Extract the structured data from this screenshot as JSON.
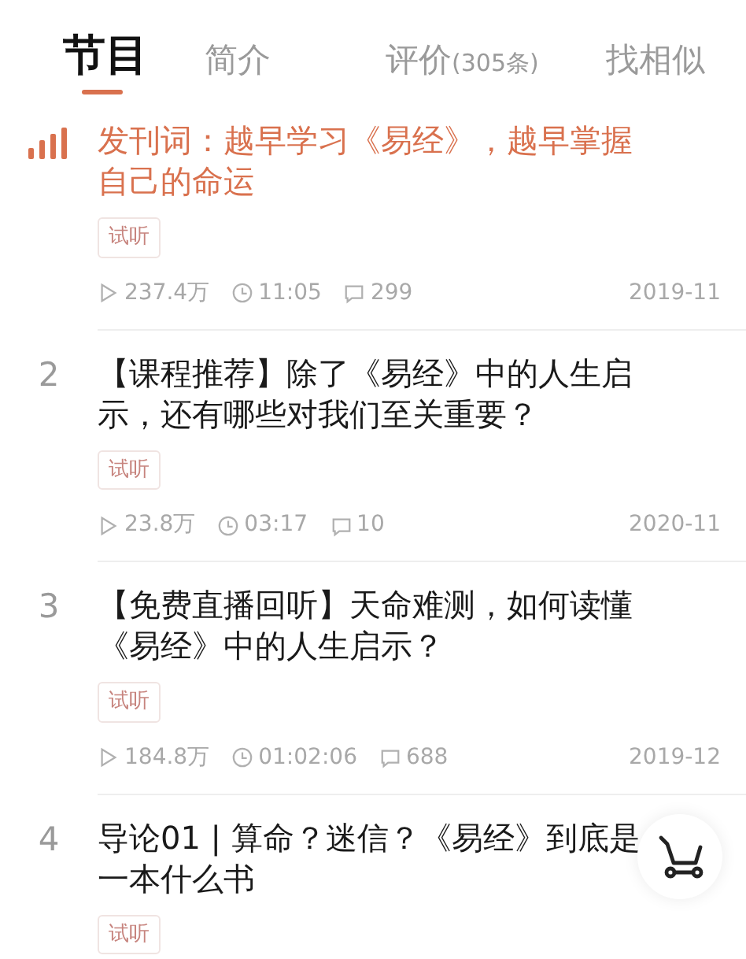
{
  "tabs": [
    {
      "label": "节目",
      "selected": true
    },
    {
      "label": "简介",
      "selected": false
    },
    {
      "label": "评价",
      "count": "(305条)",
      "selected": false
    },
    {
      "label": "找相似",
      "selected": false
    }
  ],
  "episodes": [
    {
      "playing": true,
      "title": "发刊词：越早学习《易经》，越早掌握自己的命运",
      "tag": "试听",
      "plays": "237.4万",
      "duration": "11:05",
      "comments": "299",
      "date": "2019-11"
    },
    {
      "playing": false,
      "number": "2",
      "title": "【课程推荐】除了《易经》中的人生启示，还有哪些对我们至关重要？",
      "tag": "试听",
      "plays": "23.8万",
      "duration": "03:17",
      "comments": "10",
      "date": "2020-11"
    },
    {
      "playing": false,
      "number": "3",
      "title": "【免费直播回听】天命难测，如何读懂《易经》中的人生启示？",
      "tag": "试听",
      "plays": "184.8万",
      "duration": "01:02:06",
      "comments": "688",
      "date": "2019-12"
    },
    {
      "playing": false,
      "number": "4",
      "title": "导论01 | 算命？迷信？《易经》到底是一本什么书",
      "tag": "试听"
    }
  ]
}
